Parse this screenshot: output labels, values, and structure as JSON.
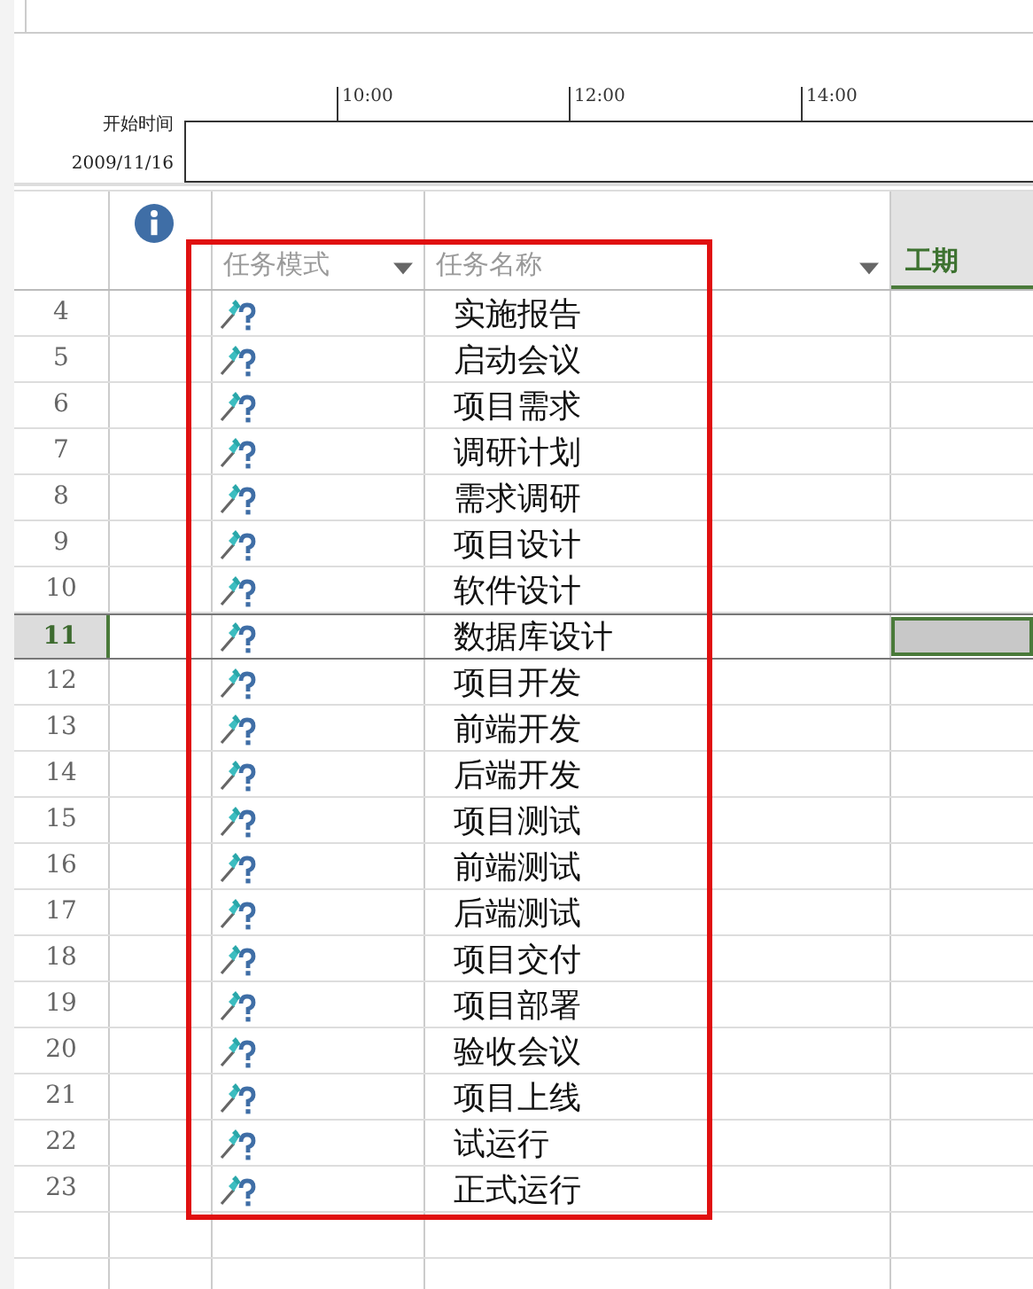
{
  "timeline": {
    "start_label": "开始时间",
    "start_date": "2009/11/16",
    "ticks": [
      "10:00",
      "12:00",
      "14:00"
    ]
  },
  "table": {
    "columns": [
      {
        "label": "任务模式",
        "kind": "mode"
      },
      {
        "label": "任务名称",
        "kind": "name"
      },
      {
        "label": "工期",
        "kind": "duration"
      }
    ],
    "rows": [
      {
        "id": "4",
        "name": "实施报告",
        "selected": false
      },
      {
        "id": "5",
        "name": "启动会议",
        "selected": false
      },
      {
        "id": "6",
        "name": "项目需求",
        "selected": false
      },
      {
        "id": "7",
        "name": "调研计划",
        "selected": false
      },
      {
        "id": "8",
        "name": "需求调研",
        "selected": false
      },
      {
        "id": "9",
        "name": "项目设计",
        "selected": false
      },
      {
        "id": "10",
        "name": "软件设计",
        "selected": false
      },
      {
        "id": "11",
        "name": "数据库设计",
        "selected": true
      },
      {
        "id": "12",
        "name": "项目开发",
        "selected": false
      },
      {
        "id": "13",
        "name": "前端开发",
        "selected": false
      },
      {
        "id": "14",
        "name": "后端开发",
        "selected": false
      },
      {
        "id": "15",
        "name": "项目测试",
        "selected": false
      },
      {
        "id": "16",
        "name": "前端测试",
        "selected": false
      },
      {
        "id": "17",
        "name": "后端测试",
        "selected": false
      },
      {
        "id": "18",
        "name": "项目交付",
        "selected": false
      },
      {
        "id": "19",
        "name": "项目部署",
        "selected": false
      },
      {
        "id": "20",
        "name": "验收会议",
        "selected": false
      },
      {
        "id": "21",
        "name": "项目上线",
        "selected": false
      },
      {
        "id": "22",
        "name": "试运行",
        "selected": false
      },
      {
        "id": "23",
        "name": "正式运行",
        "selected": false
      }
    ]
  }
}
